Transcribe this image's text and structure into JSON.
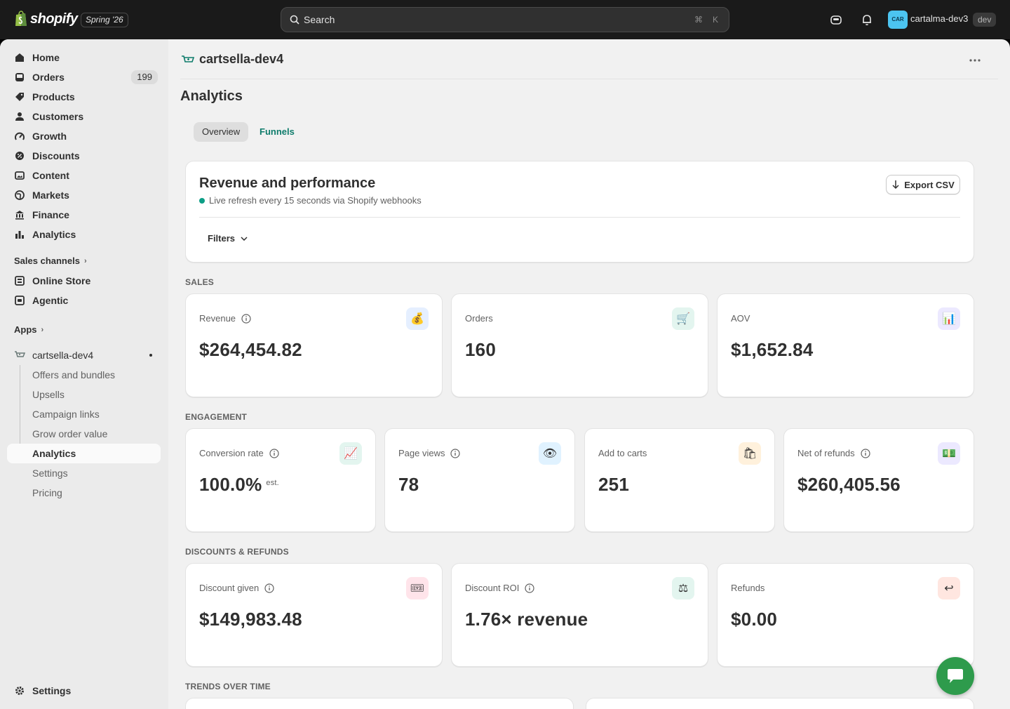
{
  "topbar": {
    "brand": "shopify",
    "edition": "Spring '26",
    "search_placeholder": "Search",
    "shortcut_cmd": "⌘",
    "shortcut_key": "K",
    "store_initials": "CAR",
    "store_name": "cartalma-dev3",
    "store_badge": "dev"
  },
  "sidebar": {
    "items": [
      {
        "label": "Home",
        "icon": "home-icon"
      },
      {
        "label": "Orders",
        "icon": "inbox-icon",
        "count": "199"
      },
      {
        "label": "Products",
        "icon": "tag-icon"
      },
      {
        "label": "Customers",
        "icon": "person-icon"
      },
      {
        "label": "Growth",
        "icon": "gauge-icon"
      },
      {
        "label": "Discounts",
        "icon": "discount-icon"
      },
      {
        "label": "Content",
        "icon": "image-icon"
      },
      {
        "label": "Markets",
        "icon": "globe-icon"
      },
      {
        "label": "Finance",
        "icon": "bank-icon"
      },
      {
        "label": "Analytics",
        "icon": "bar-chart-icon"
      }
    ],
    "sales_channels_label": "Sales channels",
    "channels": [
      {
        "label": "Online Store",
        "icon": "store-icon"
      },
      {
        "label": "Agentic",
        "icon": "agent-icon"
      }
    ],
    "apps_label": "Apps",
    "app_name": "cartsella-dev4",
    "app_subitems": [
      "Offers and bundles",
      "Upsells",
      "Campaign links",
      "Grow order value",
      "Analytics",
      "Settings",
      "Pricing"
    ],
    "settings_label": "Settings"
  },
  "main": {
    "app_title": "cartsella-dev4",
    "page_title": "Analytics",
    "tabs": [
      {
        "label": "Overview",
        "active": true
      },
      {
        "label": "Funnels",
        "active": false
      }
    ],
    "revenue_card": {
      "title": "Revenue and performance",
      "live_text": "Live refresh every 15 seconds via Shopify webhooks",
      "export_label": "Export CSV",
      "filters_label": "Filters"
    },
    "sections": {
      "sales": "SALES",
      "engagement": "ENGAGEMENT",
      "discounts": "DISCOUNTS & REFUNDS",
      "trends": "TRENDS OVER TIME"
    },
    "sales_metrics": [
      {
        "label": "Revenue",
        "value": "$264,454.82",
        "icon": "money-bag-icon",
        "bg": "#e5efff",
        "glyph": "💰",
        "info": true
      },
      {
        "label": "Orders",
        "value": "160",
        "icon": "cart-icon",
        "bg": "#e3f5ef",
        "glyph": "🛒",
        "info": false
      },
      {
        "label": "AOV",
        "value": "$1,652.84",
        "icon": "bar-chart-icon",
        "bg": "#ece9ff",
        "glyph": "📊",
        "info": false
      }
    ],
    "engagement_metrics": [
      {
        "label": "Conversion rate",
        "value": "100.0%",
        "suffix": "est.",
        "icon": "trend-up-icon",
        "bg": "#e3f5ef",
        "glyph": "📈",
        "info": true
      },
      {
        "label": "Page views",
        "value": "78",
        "icon": "eye-icon",
        "bg": "#e0f2ff",
        "glyph": "👁",
        "info": true
      },
      {
        "label": "Add to carts",
        "value": "251",
        "icon": "shopping-bags-icon",
        "bg": "#fff1dc",
        "glyph": "🛍",
        "info": false
      },
      {
        "label": "Net of refunds",
        "value": "$260,405.56",
        "icon": "banknote-icon",
        "bg": "#ece9ff",
        "glyph": "💵",
        "info": true
      }
    ],
    "discount_metrics": [
      {
        "label": "Discount given",
        "value": "$149,983.48",
        "icon": "ticket-icon",
        "bg": "#ffe4ea",
        "glyph": "🎟",
        "info": true
      },
      {
        "label": "Discount ROI",
        "value": "1.76× revenue",
        "icon": "scale-icon",
        "bg": "#e3f5ef",
        "glyph": "⚖",
        "info": true
      },
      {
        "label": "Refunds",
        "value": "$0.00",
        "icon": "return-arrow-icon",
        "bg": "#ffe6e0",
        "glyph": "↩",
        "info": false
      }
    ]
  },
  "colors": {
    "accent_teal": "#0e7c6b",
    "live_dot": "#0c9e86",
    "chat_green": "#2e9b4c",
    "topbar_bg": "#1a1a1a"
  }
}
